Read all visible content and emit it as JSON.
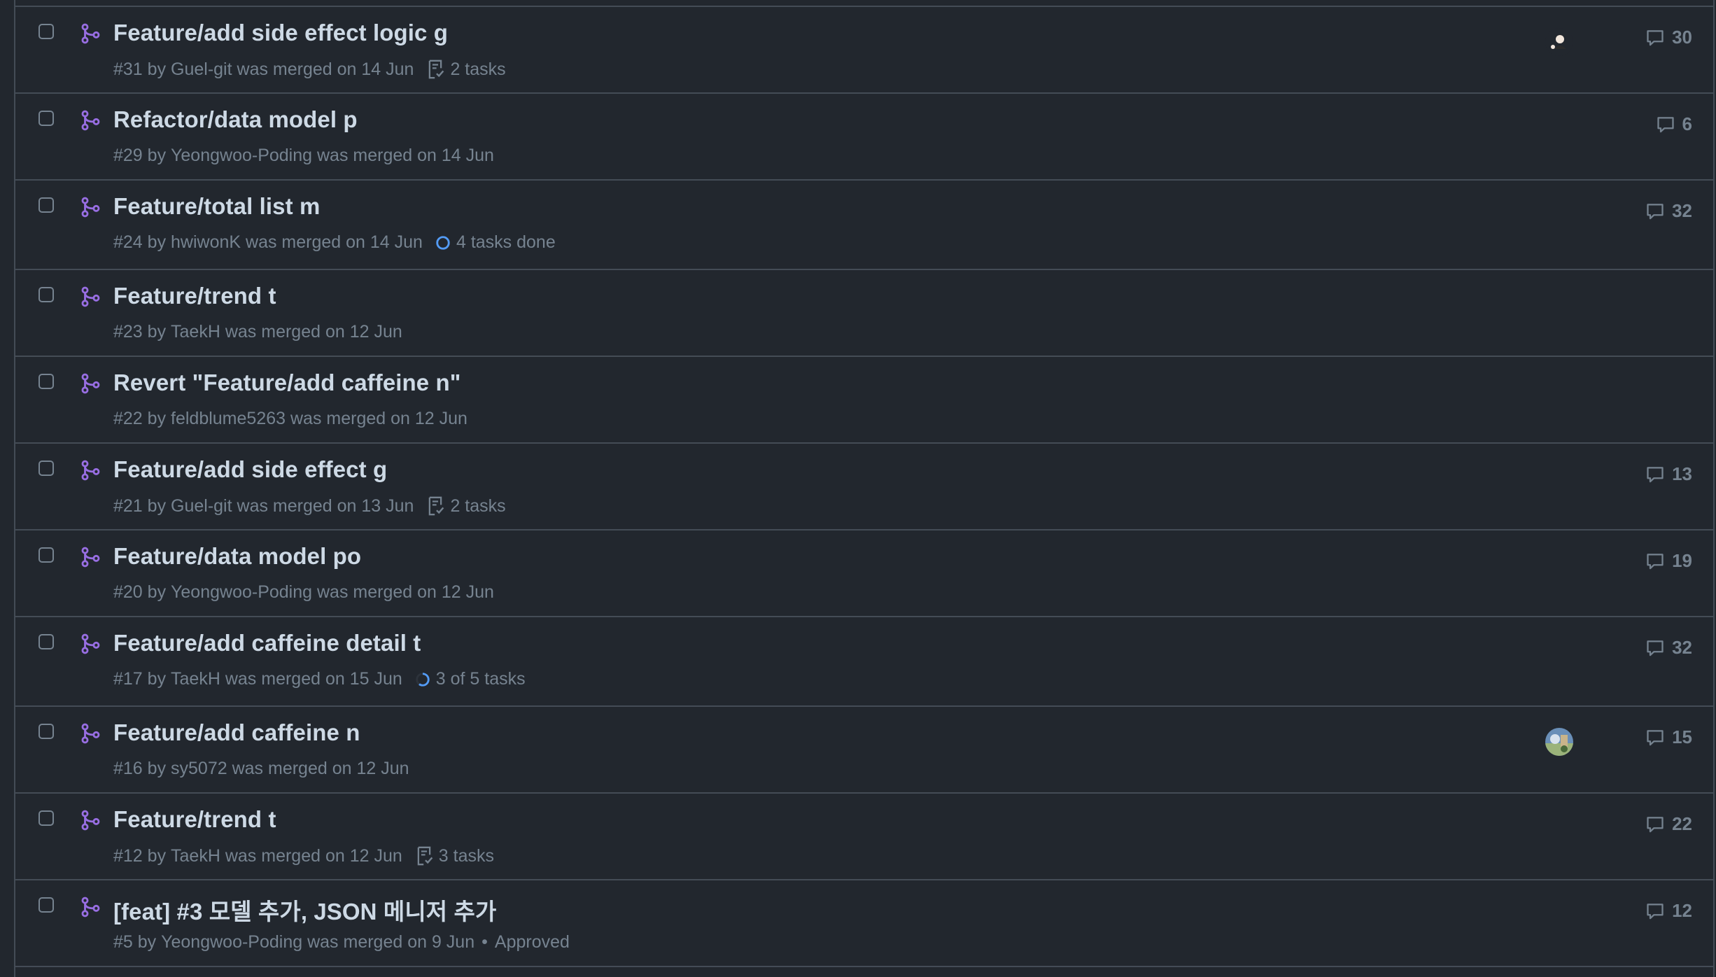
{
  "colors": {
    "background": "#22272e",
    "border": "#444c56",
    "merged_purple": "#986ee2",
    "title_text": "#cdd9e5",
    "muted_text": "#768390",
    "progress_blue": "#539bf5"
  },
  "pull_requests": [
    {
      "title": "Feature/add side effect logic g",
      "number": "#31",
      "author": "Guel-git",
      "status": "was merged on 14 Jun",
      "tasks_icon": "checklist-icon",
      "tasks_label": "2 tasks",
      "has_avatar": true,
      "avatar_style": "dark-figure",
      "comments": "30"
    },
    {
      "title": "Refactor/data model p",
      "number": "#29",
      "author": "Yeongwoo-Poding",
      "status": "was merged on 14 Jun",
      "comments": "6"
    },
    {
      "title": "Feature/total list m",
      "number": "#24",
      "author": "hwiwonK",
      "status": "was merged on 14 Jun",
      "tasks_icon": "progress-ring-icon",
      "tasks_progress": 1.0,
      "tasks_label": "4 tasks done",
      "comments": "32"
    },
    {
      "title": "Feature/trend t",
      "number": "#23",
      "author": "TaekH",
      "status": "was merged on 12 Jun"
    },
    {
      "title": "Revert \"Feature/add caffeine n\"",
      "number": "#22",
      "author": "feldblume5263",
      "status": "was merged on 12 Jun"
    },
    {
      "title": "Feature/add side effect g",
      "number": "#21",
      "author": "Guel-git",
      "status": "was merged on 13 Jun",
      "tasks_icon": "checklist-icon",
      "tasks_label": "2 tasks",
      "comments": "13"
    },
    {
      "title": "Feature/data model po",
      "number": "#20",
      "author": "Yeongwoo-Poding",
      "status": "was merged on 12 Jun",
      "comments": "19"
    },
    {
      "title": "Feature/add caffeine detail t",
      "number": "#17",
      "author": "TaekH",
      "status": "was merged on 15 Jun",
      "tasks_icon": "progress-ring-icon",
      "tasks_progress": 0.6,
      "tasks_label": "3 of 5 tasks",
      "comments": "32"
    },
    {
      "title": "Feature/add caffeine n",
      "number": "#16",
      "author": "sy5072",
      "status": "was merged on 12 Jun",
      "has_avatar": true,
      "avatar_style": "photo",
      "comments": "15"
    },
    {
      "title": "Feature/trend t",
      "number": "#12",
      "author": "TaekH",
      "status": "was merged on 12 Jun",
      "tasks_icon": "checklist-icon",
      "tasks_label": "3 tasks",
      "comments": "22"
    },
    {
      "title": "[feat] #3 모델 추가, JSON 메니저 추가",
      "number": "#5",
      "author": "Yeongwoo-Poding",
      "status": "was merged on 9 Jun",
      "review_separator": "•",
      "review": "Approved",
      "comments": "12"
    }
  ]
}
